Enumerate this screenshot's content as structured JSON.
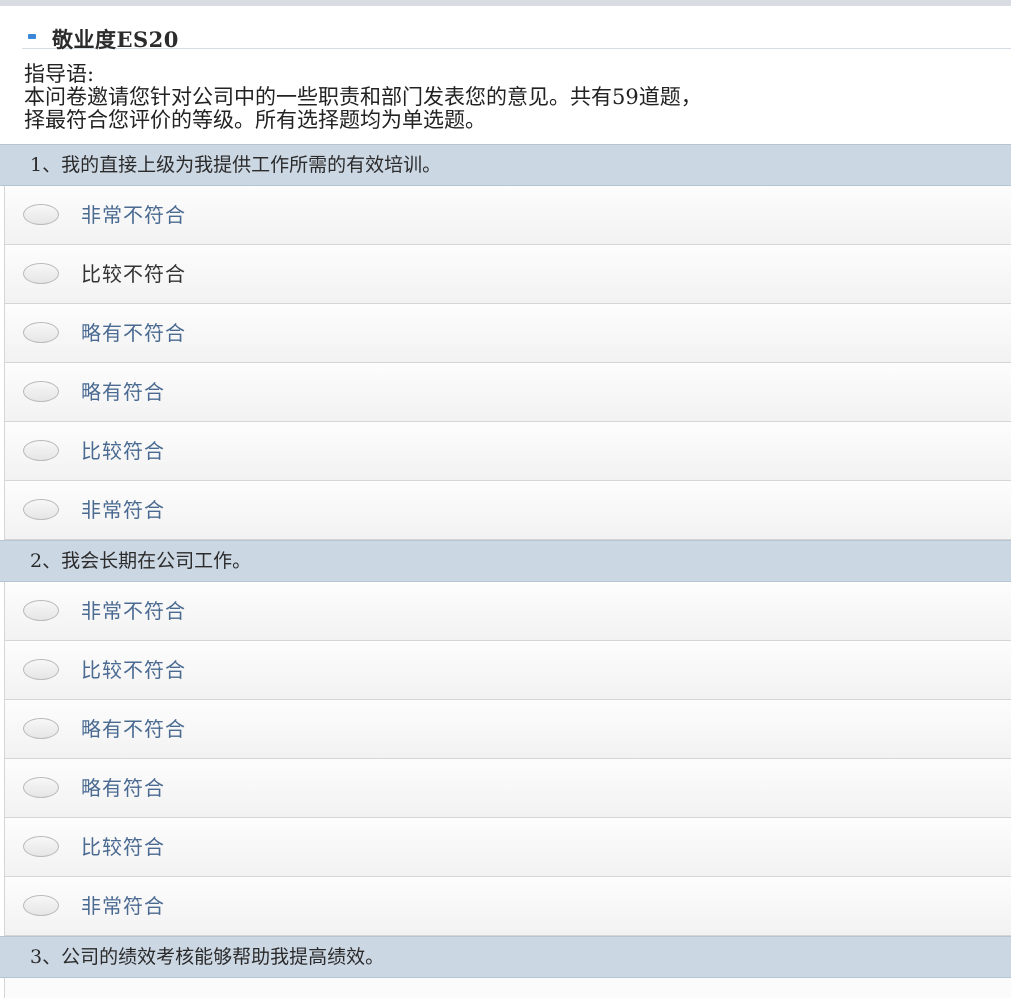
{
  "survey": {
    "title": "敬业度ES20",
    "intro_label": "指导语:",
    "intro_line1": "本问卷邀请您针对公司中的一些职责和部门发表您的意见。共有59道题，",
    "intro_line2": "择最符合您评价的等级。所有选择题均为单选题。"
  },
  "questions": [
    {
      "title": "1、我的直接上级为我提供工作所需的有效培训。",
      "options": [
        "非常不符合",
        "比较不符合",
        "略有不符合",
        "略有符合",
        "比较符合",
        "非常符合"
      ]
    },
    {
      "title": "2、我会长期在公司工作。",
      "options": [
        "非常不符合",
        "比较不符合",
        "略有不符合",
        "略有符合",
        "比较符合",
        "非常符合"
      ]
    },
    {
      "title": "3、公司的绩效考核能够帮助我提高绩效。",
      "options": []
    }
  ],
  "colors": {
    "question_bar": "#ccd7e4",
    "option_text": "#4a6a91",
    "header_marker": "#3b87d8"
  },
  "icons": {
    "radio": "radio-circle-icon",
    "header_marker": "header-marker-icon"
  }
}
